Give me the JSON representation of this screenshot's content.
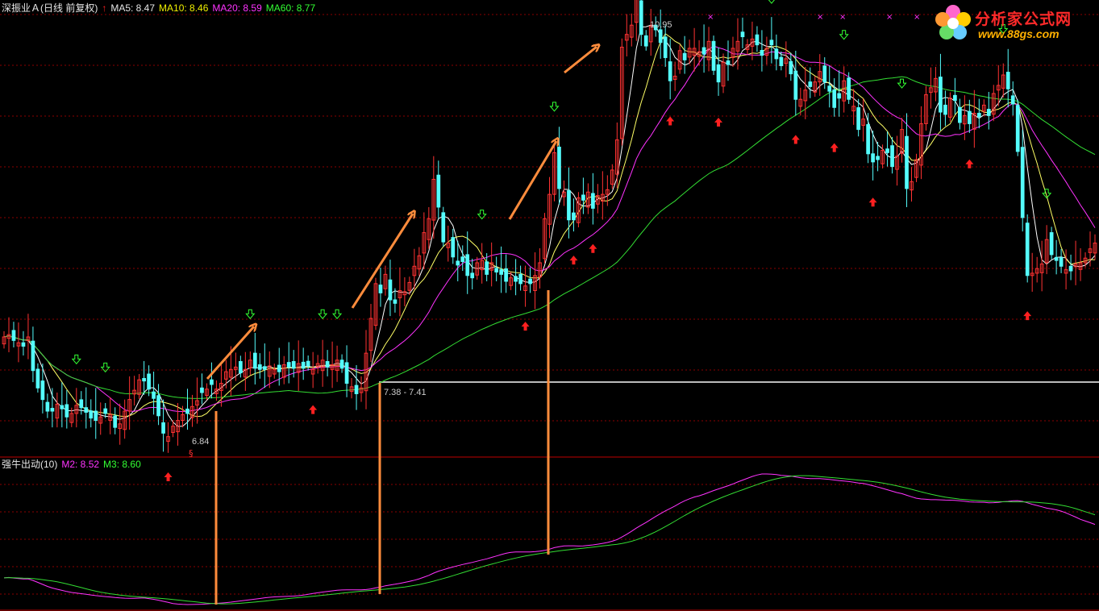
{
  "header": {
    "stock_name": "深振业Ａ(日线 前复权)",
    "ma5": "MA5: 8.47",
    "ma10": "MA10: 8.46",
    "ma20": "MA20: 8.59",
    "ma60": "MA60: 8.77"
  },
  "indicator_header": {
    "name": "强牛出动(10)",
    "m2": "M2: 8.52",
    "m3": "M3: 8.60"
  },
  "logo": {
    "title": "分析家公式网",
    "url": "www.88gs.com"
  },
  "price_annotations": {
    "high_label": "10.95",
    "low_label": "6.84",
    "range_label": "7.38 - 7.41",
    "marker_s": "§"
  },
  "colors": {
    "background": "#000000",
    "up_candle": "#ff3232",
    "down_candle": "#54fcfc",
    "ma5": "#ffffff",
    "ma10": "#ffff66",
    "ma20": "#ff33ff",
    "ma60": "#33dd33",
    "grid": "#8b0000",
    "arrow_orange": "#ff8c3c",
    "buy_arrow": "#ff2020",
    "sell_arrow": "#33ff33"
  },
  "chart_data": [
    {
      "type": "candlestick",
      "title": "深振业Ａ(日线 前复权)",
      "series": [
        "MA5",
        "MA10",
        "MA20",
        "MA60"
      ],
      "ylim": [
        6.5,
        11.2
      ],
      "key_levels": {
        "high": 10.95,
        "low": 6.84,
        "range": [
          7.38,
          7.41
        ]
      },
      "closes": [
        7.84,
        7.86,
        7.81,
        7.79,
        7.76,
        7.84,
        7.55,
        7.4,
        7.3,
        7.2,
        7.2,
        7.26,
        7.22,
        7.15,
        7.18,
        7.25,
        7.23,
        7.19,
        7.14,
        7.12,
        7.15,
        7.18,
        7.17,
        7.06,
        7.09,
        7.2,
        7.3,
        7.38,
        7.47,
        7.46,
        7.39,
        7.31,
        7.16,
        7.01,
        6.98,
        7.07,
        7.12,
        7.17,
        7.18,
        7.24,
        7.29,
        7.36,
        7.39,
        7.43,
        7.39,
        7.44,
        7.54,
        7.56,
        7.58,
        7.53,
        7.56,
        7.64,
        7.57,
        7.56,
        7.56,
        7.59,
        7.56,
        7.54,
        7.6,
        7.58,
        7.57,
        7.61,
        7.57,
        7.59,
        7.56,
        7.61,
        7.64,
        7.58,
        7.6,
        7.64,
        7.57,
        7.44,
        7.41,
        7.35,
        7.4,
        7.7,
        8.0,
        8.3,
        8.22,
        8.38,
        8.16,
        8.13,
        8.24,
        8.23,
        8.31,
        8.45,
        8.54,
        8.74,
        8.86,
        9.2,
        8.96,
        8.66,
        8.65,
        8.53,
        8.46,
        8.49,
        8.37,
        8.35,
        8.48,
        8.5,
        8.38,
        8.48,
        8.4,
        8.38,
        8.32,
        8.35,
        8.32,
        8.3,
        8.28,
        8.3,
        8.37,
        8.48,
        8.86,
        9.07,
        9.43,
        9.12,
        9.09,
        8.85,
        8.85,
        9.04,
        9.02,
        9.09,
        8.95,
        9.06,
        9.07,
        9.11,
        9.28,
        9.54,
        10.34,
        10.45,
        10.53,
        10.8,
        10.45,
        10.35,
        10.52,
        10.49,
        10.38,
        10.25,
        10.05,
        10.09,
        10.31,
        10.23,
        10.33,
        10.33,
        10.3,
        10.28,
        10.39,
        10.14,
        10.04,
        10.21,
        10.19,
        10.33,
        10.39,
        10.43,
        10.36,
        10.41,
        10.36,
        10.27,
        10.33,
        10.36,
        10.24,
        10.18,
        10.24,
        10.11,
        9.89,
        9.89,
        9.97,
        10.0,
        10.04,
        10.13,
        10.04,
        9.96,
        9.82,
        9.9,
        10.05,
        9.89,
        9.83,
        9.63,
        9.72,
        9.42,
        9.35,
        9.37,
        9.45,
        9.43,
        9.31,
        9.4,
        9.63,
        9.12,
        9.18,
        9.37,
        9.68,
        9.93,
        9.99,
        10.07,
        9.78,
        9.76,
        9.9,
        9.88,
        9.69,
        9.75,
        9.68,
        9.77,
        9.74,
        9.84,
        9.75,
        9.94,
        10.01,
        10.1,
        9.98,
        9.85,
        9.44,
        8.87,
        8.37,
        8.39,
        8.43,
        8.47,
        8.68,
        8.55,
        8.5,
        8.45,
        8.42,
        8.41,
        8.47,
        8.48,
        8.52,
        8.6,
        8.65
      ]
    },
    {
      "type": "line",
      "title": "强牛出动(10)",
      "series": [
        {
          "name": "M2",
          "last": 8.52
        },
        {
          "name": "M3",
          "last": 8.6
        }
      ]
    }
  ]
}
